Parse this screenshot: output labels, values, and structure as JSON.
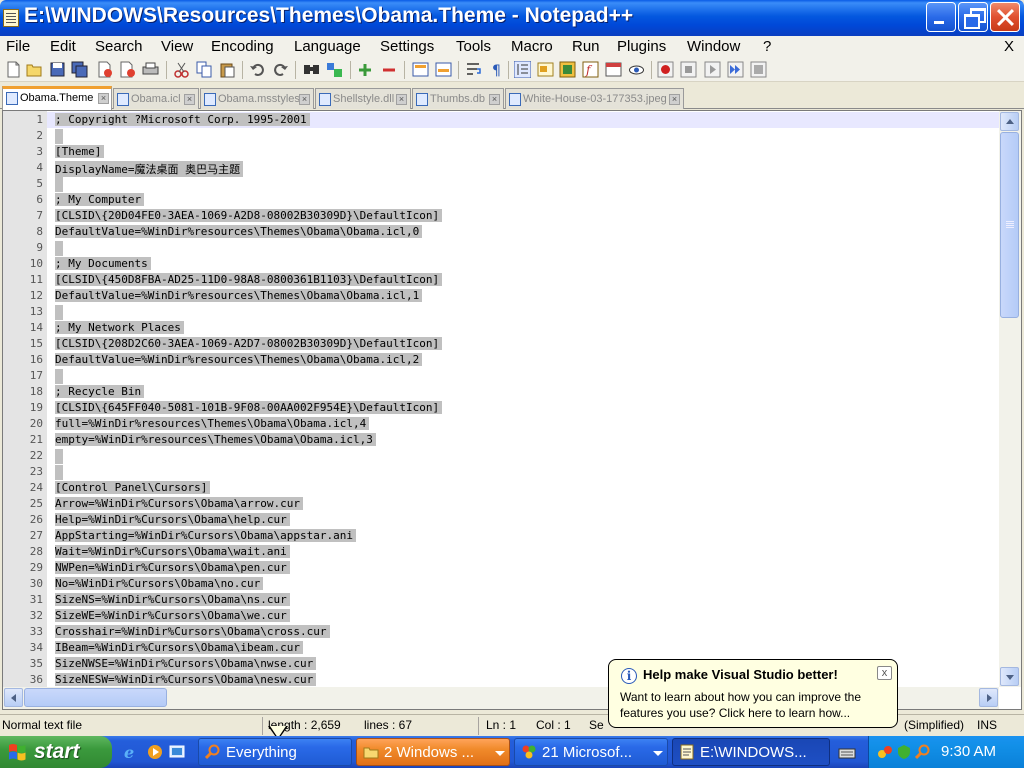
{
  "window": {
    "title": "E:\\WINDOWS\\Resources\\Themes\\Obama.Theme - Notepad++"
  },
  "menu": {
    "items": [
      "File",
      "Edit",
      "Search",
      "View",
      "Encoding",
      "Language",
      "Settings",
      "Tools",
      "Macro",
      "Run",
      "Plugins",
      "Window",
      "?"
    ],
    "close_doc": "X"
  },
  "tabs": [
    {
      "label": "Obama.Theme",
      "active": true
    },
    {
      "label": "Obama.icl",
      "active": false
    },
    {
      "label": "Obama.msstyles",
      "active": false
    },
    {
      "label": "Shellstyle.dll",
      "active": false
    },
    {
      "label": "Thumbs.db",
      "active": false
    },
    {
      "label": "White-House-03-177353.jpeg",
      "active": false
    }
  ],
  "editor": {
    "lines": [
      "; Copyright ?Microsoft Corp. 1995-2001",
      "",
      "[Theme]",
      "DisplayName=魔法桌面 奥巴马主题",
      "",
      "; My Computer",
      "[CLSID\\{20D04FE0-3AEA-1069-A2D8-08002B30309D}\\DefaultIcon]",
      "DefaultValue=%WinDir%resources\\Themes\\Obama\\Obama.icl,0",
      "",
      "; My Documents",
      "[CLSID\\{450D8FBA-AD25-11D0-98A8-0800361B1103}\\DefaultIcon]",
      "DefaultValue=%WinDir%resources\\Themes\\Obama\\Obama.icl,1",
      "",
      "; My Network Places",
      "[CLSID\\{208D2C60-3AEA-1069-A2D7-08002B30309D}\\DefaultIcon]",
      "DefaultValue=%WinDir%resources\\Themes\\Obama\\Obama.icl,2",
      "",
      "; Recycle Bin",
      "[CLSID\\{645FF040-5081-101B-9F08-00AA002F954E}\\DefaultIcon]",
      "full=%WinDir%resources\\Themes\\Obama\\Obama.icl,4",
      "empty=%WinDir%resources\\Themes\\Obama\\Obama.icl,3",
      "",
      "",
      "[Control Panel\\Cursors]",
      "Arrow=%WinDir%Cursors\\Obama\\arrow.cur",
      "Help=%WinDir%Cursors\\Obama\\help.cur",
      "AppStarting=%WinDir%Cursors\\Obama\\appstar.ani",
      "Wait=%WinDir%Cursors\\Obama\\wait.ani",
      "NWPen=%WinDir%Cursors\\Obama\\pen.cur",
      "No=%WinDir%Cursors\\Obama\\no.cur",
      "SizeNS=%WinDir%Cursors\\Obama\\ns.cur",
      "SizeWE=%WinDir%Cursors\\Obama\\we.cur",
      "Crosshair=%WinDir%Cursors\\Obama\\cross.cur",
      "IBeam=%WinDir%Cursors\\Obama\\ibeam.cur",
      "SizeNWSE=%WinDir%Cursors\\Obama\\nwse.cur",
      "SizeNESW=%WinDir%Cursors\\Obama\\nesw.cur"
    ],
    "current_line": 1
  },
  "statusbar": {
    "file_type": "Normal text file",
    "length": "length : 2,659",
    "lines": "lines : 67",
    "ln": "Ln : 1",
    "col": "Col : 1",
    "sel": "Se",
    "encoding_fragment": "(Simplified)",
    "mode": "INS"
  },
  "balloon": {
    "title": "Help make Visual Studio better!",
    "body": "Want to learn about how you can improve the features you use? Click here to learn how...",
    "close": "x"
  },
  "taskbar": {
    "start_label": "start",
    "tasks": [
      {
        "label": "Everything",
        "style": "normal",
        "icon": "search-icon"
      },
      {
        "label": "2 Windows ...",
        "style": "grouped",
        "icon": "folder-icon"
      },
      {
        "label": "21 Microsof...",
        "style": "normal",
        "icon": "office-icon"
      },
      {
        "label": "E:\\WINDOWS...",
        "style": "active",
        "icon": "notepad-icon"
      }
    ],
    "clock": "9:30 AM"
  },
  "colors": {
    "selection": "#c0c0c0",
    "gutter": "#e4e4e4",
    "current_line": "#e8e8ff",
    "tab_accent": "#f0a030",
    "balloon_bg": "#ffffe1"
  }
}
